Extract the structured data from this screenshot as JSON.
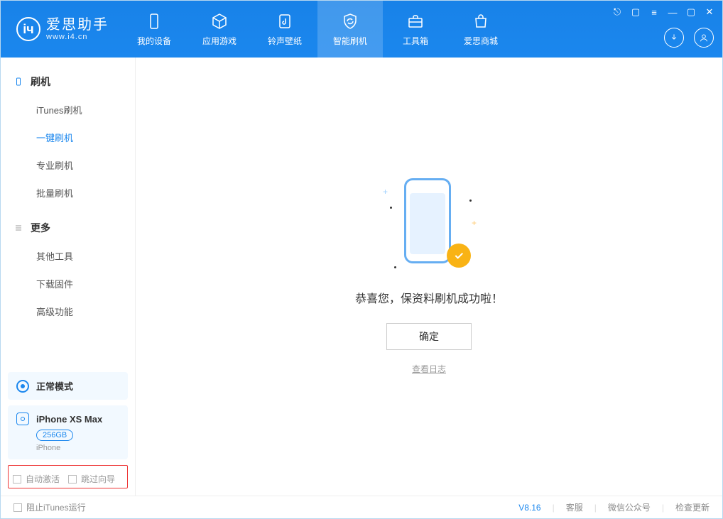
{
  "app": {
    "name": "爱思助手",
    "url": "www.i4.cn"
  },
  "tabs": {
    "device": "我的设备",
    "apps": "应用游戏",
    "ringtone": "铃声壁纸",
    "flash": "智能刷机",
    "toolbox": "工具箱",
    "store": "爱思商城"
  },
  "sidebar": {
    "cat_flash": "刷机",
    "items_flash": [
      "iTunes刷机",
      "一键刷机",
      "专业刷机",
      "批量刷机"
    ],
    "selected_flash_idx": 1,
    "cat_more": "更多",
    "items_more": [
      "其他工具",
      "下载固件",
      "高级功能"
    ]
  },
  "mode": {
    "label": "正常模式"
  },
  "device": {
    "name": "iPhone XS Max",
    "storage": "256GB",
    "type": "iPhone"
  },
  "checkboxes": {
    "auto_activate": "自动激活",
    "skip_guide": "跳过向导"
  },
  "main": {
    "success_text": "恭喜您，保资料刷机成功啦！",
    "confirm": "确定",
    "view_log": "查看日志"
  },
  "statusbar": {
    "block_itunes": "阻止iTunes运行",
    "version": "V8.16",
    "kefu": "客服",
    "wechat": "微信公众号",
    "update": "检查更新"
  }
}
